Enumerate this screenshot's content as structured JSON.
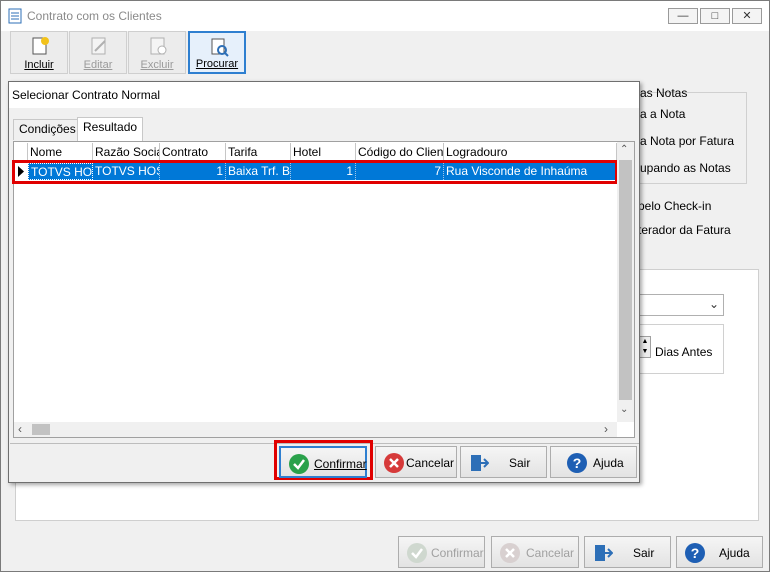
{
  "window": {
    "title": "Contrato com os Clientes",
    "controls": {
      "minimize": "—",
      "maximize": "□",
      "close": "✕"
    }
  },
  "toolbar": {
    "incluir": "Incluir",
    "editar": "Editar",
    "excluir": "Excluir",
    "procurar": "Procurar"
  },
  "background": {
    "group_title": "as Notas",
    "opt1": "a a Nota",
    "opt2": "a Nota por Fatura",
    "opt3": "upando as Notas",
    "check1": "pelo Check-in",
    "check2": "terador da Fatura",
    "dias_antes": "Dias Antes"
  },
  "dialog": {
    "title": "Selecionar Contrato Normal",
    "tabs": [
      "Condições",
      "Resultado"
    ],
    "active_tab": "Resultado",
    "columns": [
      "Nome",
      "Razão Social",
      "Contrato",
      "Tarifa",
      "Hotel",
      "Código do Cliente",
      "Logradouro"
    ],
    "rows": [
      {
        "nome": "TOTVS HOSP",
        "razao": "TOTVS HOSP",
        "contrato": "1",
        "tarifa": "Baixa Trf. Ba",
        "hotel": "1",
        "codigo": "7",
        "logradouro": "Rua Visconde de Inhaúma"
      }
    ],
    "buttons": {
      "confirmar": "Confirmar",
      "cancelar": "Cancelar",
      "sair": "Sair",
      "ajuda": "Ajuda"
    }
  },
  "footer": {
    "confirmar": "Confirmar",
    "cancelar": "Cancelar",
    "sair": "Sair",
    "ajuda": "Ajuda"
  },
  "colors": {
    "selection": "#0078d7",
    "highlight": "#e00000",
    "confirm_green": "#2aa14b",
    "cancel_red": "#d63a3a",
    "help_blue": "#1e5fb4"
  }
}
